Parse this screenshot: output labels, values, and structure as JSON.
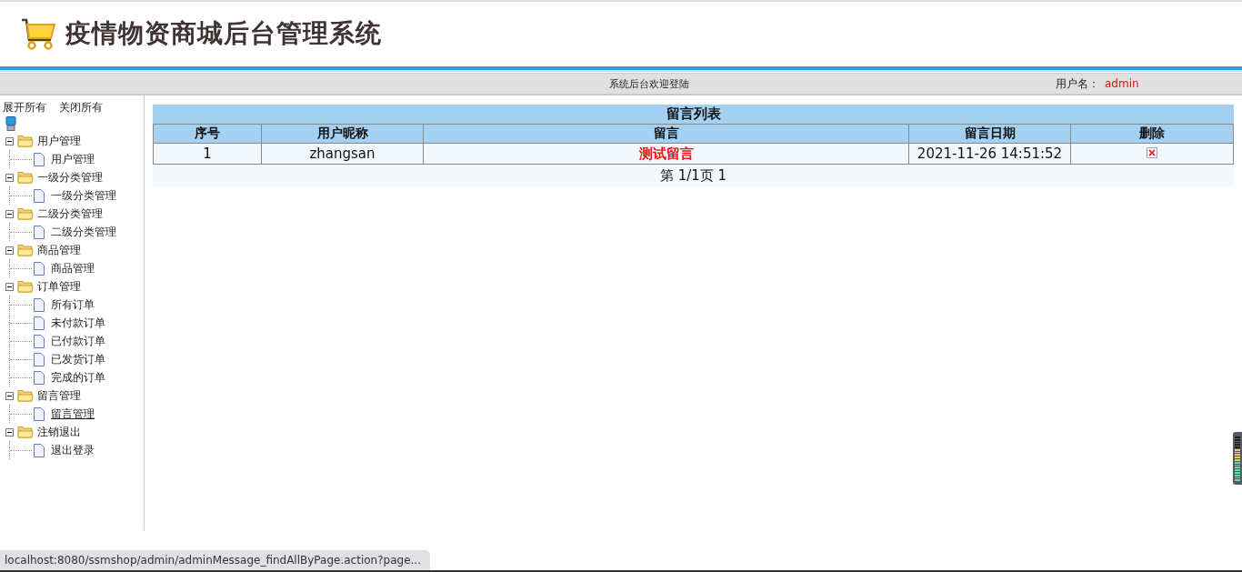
{
  "header": {
    "title": "疫情物资商城后台管理系统"
  },
  "top_bar": {
    "welcome": "系统后台欢迎登陆",
    "user_label": "用户名：",
    "user_name": "admin"
  },
  "sidebar": {
    "expand_all": "展开所有",
    "collapse_all": "关闭所有",
    "tree": [
      {
        "label": "用户管理",
        "expanded": true,
        "children": [
          {
            "label": "用户管理",
            "selected": false
          }
        ]
      },
      {
        "label": "一级分类管理",
        "expanded": true,
        "children": [
          {
            "label": "一级分类管理",
            "selected": false
          }
        ]
      },
      {
        "label": "二级分类管理",
        "expanded": true,
        "children": [
          {
            "label": "二级分类管理",
            "selected": false
          }
        ]
      },
      {
        "label": "商品管理",
        "expanded": true,
        "children": [
          {
            "label": "商品管理",
            "selected": false
          }
        ]
      },
      {
        "label": "订单管理",
        "expanded": true,
        "children": [
          {
            "label": "所有订单",
            "selected": false
          },
          {
            "label": "未付款订单",
            "selected": false
          },
          {
            "label": "已付款订单",
            "selected": false
          },
          {
            "label": "已发货订单",
            "selected": false
          },
          {
            "label": "完成的订单",
            "selected": false
          }
        ]
      },
      {
        "label": "留言管理",
        "expanded": true,
        "children": [
          {
            "label": "留言管理",
            "selected": true
          }
        ]
      },
      {
        "label": "注销退出",
        "expanded": true,
        "children": [
          {
            "label": "退出登录",
            "selected": false
          }
        ]
      }
    ]
  },
  "table": {
    "title": "留言列表",
    "columns": [
      "序号",
      "用户昵称",
      "留言",
      "留言日期",
      "删除"
    ],
    "rows": [
      {
        "index": "1",
        "nickname": "zhangsan",
        "message": "测试留言",
        "date": "2021-11-26 14:51:52"
      }
    ],
    "pager": "第 1/1页 1"
  },
  "status_bar": {
    "url": "localhost:8080/ssmshop/admin/adminMessage_findAllByPage.action?page..."
  }
}
